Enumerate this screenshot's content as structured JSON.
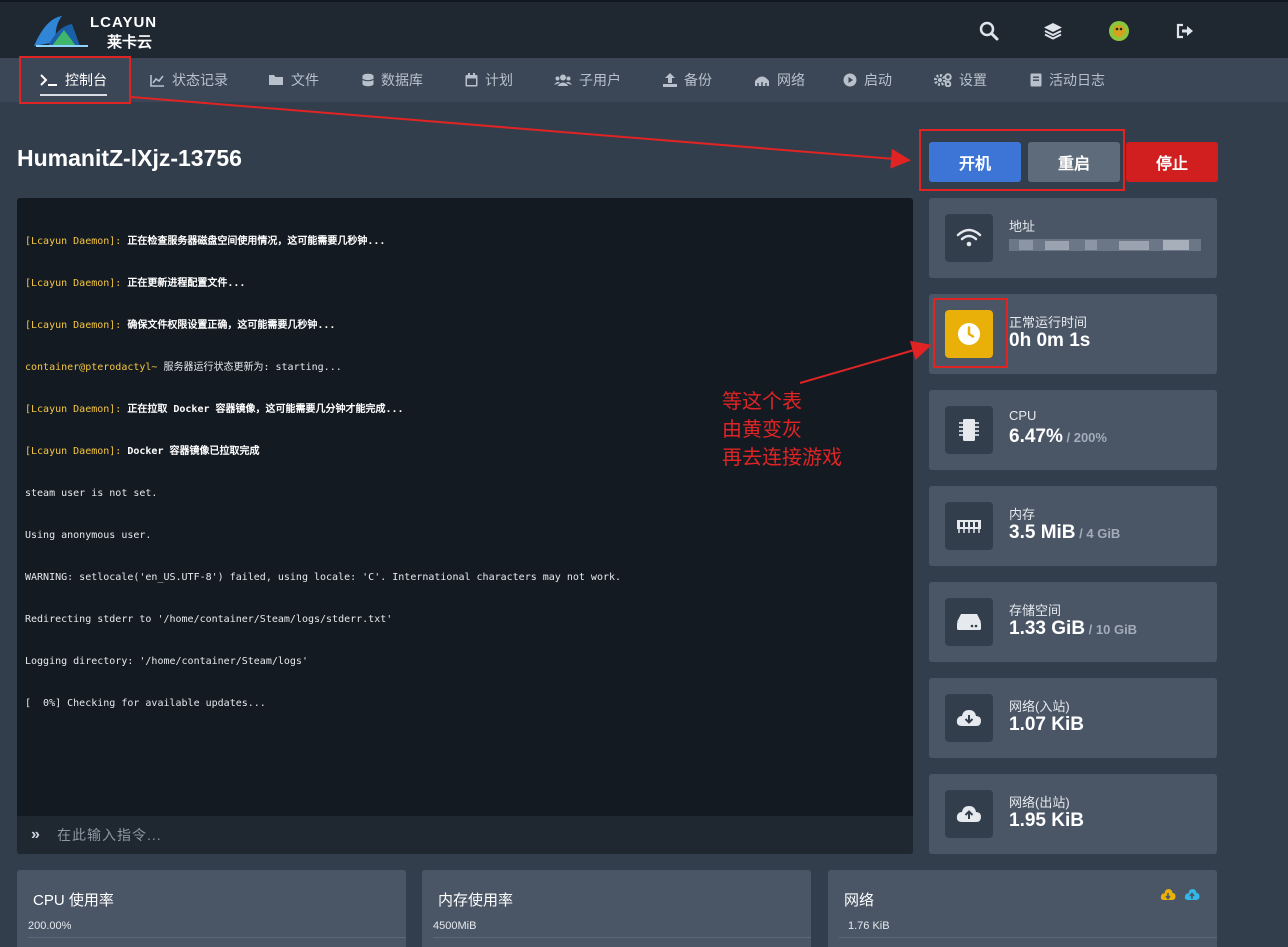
{
  "brand": {
    "name": "LCAYUN",
    "sub": "莱卡云"
  },
  "topbar": {
    "icons": [
      "search-icon",
      "layers-icon",
      "user-avatar-icon",
      "logout-icon"
    ]
  },
  "nav": {
    "items": [
      {
        "label": "控制台",
        "icon": "terminal-icon",
        "active": true
      },
      {
        "label": "状态记录",
        "icon": "chart-icon"
      },
      {
        "label": "文件",
        "icon": "folder-icon"
      },
      {
        "label": "数据库",
        "icon": "database-icon"
      },
      {
        "label": "计划",
        "icon": "calendar-icon"
      },
      {
        "label": "子用户",
        "icon": "users-icon"
      },
      {
        "label": "备份",
        "icon": "upload-icon"
      },
      {
        "label": "网络",
        "icon": "network-icon"
      },
      {
        "label": "启动",
        "icon": "play-icon"
      },
      {
        "label": "设置",
        "icon": "cogs-icon"
      },
      {
        "label": "活动日志",
        "icon": "log-icon"
      }
    ]
  },
  "server": {
    "name": "HumanitZ-lXjz-13756"
  },
  "power": {
    "start": "开机",
    "restart": "重启",
    "stop": "停止"
  },
  "console": {
    "lines": [
      {
        "prefix": "[Lcayun Daemon]:",
        "text": " 正在检查服务器磁盘空间使用情况，这可能需要几秒钟...",
        "bold": true
      },
      {
        "prefix": "[Lcayun Daemon]:",
        "text": " 正在更新进程配置文件...",
        "bold": true
      },
      {
        "prefix": "[Lcayun Daemon]:",
        "text": " 确保文件权限设置正确，这可能需要几秒钟...",
        "bold": true
      },
      {
        "prefix": "container@pterodactyl~",
        "text": " 服务器运行状态更新为: starting...",
        "bold": false
      },
      {
        "prefix": "[Lcayun Daemon]:",
        "text": " 正在拉取 Docker 容器镜像，这可能需要几分钟才能完成...",
        "bold": true
      },
      {
        "prefix": "[Lcayun Daemon]:",
        "text": " Docker 容器镜像已拉取完成",
        "bold": true
      },
      {
        "prefix": "",
        "text": "steam user is not set.",
        "bold": false
      },
      {
        "prefix": "",
        "text": "Using anonymous user.",
        "bold": false
      },
      {
        "prefix": "",
        "text": "WARNING: setlocale('en_US.UTF-8') failed, using locale: 'C'. International characters may not work.",
        "bold": false
      },
      {
        "prefix": "",
        "text": "Redirecting stderr to '/home/container/Steam/logs/stderr.txt'",
        "bold": false
      },
      {
        "prefix": "",
        "text": "Logging directory: '/home/container/Steam/logs'",
        "bold": false
      },
      {
        "prefix": "",
        "text": "[  0%] Checking for available updates...",
        "bold": false
      }
    ],
    "prompt": "»",
    "placeholder": "在此输入指令..."
  },
  "annotation": {
    "lines": [
      "等这个表",
      "由黄变灰",
      "再去连接游戏"
    ],
    "color": "#e02424"
  },
  "stats": [
    {
      "label": "地址",
      "value": "",
      "limit": "",
      "icon": "wifi-icon"
    },
    {
      "label": "正常运行时间",
      "value": "0h 0m 1s",
      "limit": "",
      "icon": "clock-icon",
      "highlight": "#e9b00a"
    },
    {
      "label": "CPU",
      "value": "6.47%",
      "limit": " / 200%",
      "icon": "cpu-icon"
    },
    {
      "label": "内存",
      "value": "3.5 MiB",
      "limit": " / 4 GiB",
      "icon": "memory-icon"
    },
    {
      "label": "存储空间",
      "value": "1.33 GiB",
      "limit": " / 10 GiB",
      "icon": "hdd-icon"
    },
    {
      "label": "网络(入站)",
      "value": "1.07 KiB",
      "limit": "",
      "icon": "cloud-download-icon"
    },
    {
      "label": "网络(出站)",
      "value": "1.95 KiB",
      "limit": "",
      "icon": "cloud-upload-icon"
    }
  ],
  "charts": [
    {
      "title": "CPU 使用率",
      "top_tick": "200.00%"
    },
    {
      "title": "内存使用率",
      "top_tick": "4500MiB"
    },
    {
      "title": "网络",
      "top_tick": "1.76 KiB",
      "legend_icons": [
        "cloud-download-icon",
        "cloud-upload-icon"
      ]
    }
  ],
  "colors": {
    "primary": "#3d75d6",
    "danger": "#d11e1e",
    "secondary": "#5e6b7b",
    "warning": "#e9b00a"
  }
}
